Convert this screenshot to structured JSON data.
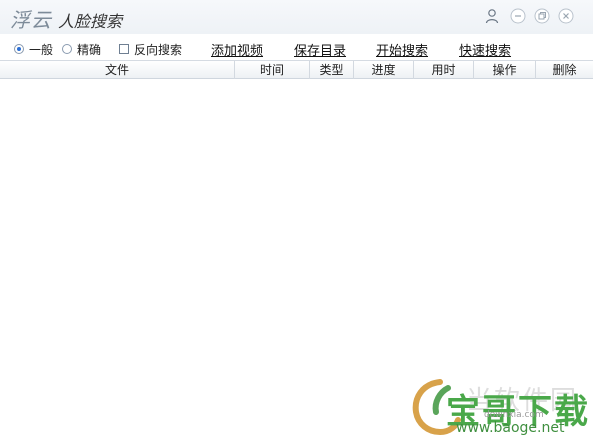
{
  "app": {
    "title_brand": "浮云",
    "title_rest": "人脸搜索"
  },
  "window_controls": {
    "user_icon": "user-icon",
    "minimize_icon": "minimize-icon",
    "restore_icon": "restore-icon",
    "close_icon": "close-icon"
  },
  "toolbar": {
    "mode_general": "一般",
    "mode_precise": "精确",
    "reverse_search": "反向搜索",
    "add_video": "添加视频",
    "save_dir": "保存目录",
    "start_search": "开始搜索",
    "quick_search": "快速搜索",
    "selected_mode": "一般"
  },
  "table": {
    "columns": [
      "文件",
      "时间",
      "类型",
      "进度",
      "用时",
      "操作",
      "删除"
    ],
    "rows": []
  },
  "watermark": {
    "text": "当软件园",
    "brand": "宝哥下载",
    "domain": "downxia.com",
    "url": "www.baoge.net"
  },
  "colors": {
    "accent": "#2b6fd6",
    "title_brand": "#7d8b99",
    "watermark_green": "#4aa84a"
  }
}
